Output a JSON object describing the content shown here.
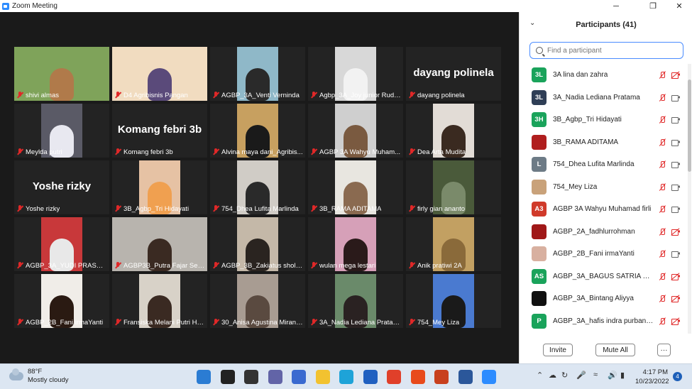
{
  "window": {
    "title": "Zoom Meeting",
    "minimize": "─",
    "maximize": "❐",
    "close": "✕"
  },
  "tiles": [
    {
      "name": "shivi almas",
      "active": true,
      "bg": "#7fa35a",
      "face": "#b07a4a",
      "wide": true
    },
    {
      "name": "D4 Agribisnis Pangan",
      "bg": "#f1dcc0",
      "face": "#5a4a7a",
      "wide": true
    },
    {
      "name": "AGBP_3A_Venti Verninda",
      "bg": "#8fb8c8",
      "face": "#2a2a2a"
    },
    {
      "name": "Agbp_3A_Joy junior Rudd...",
      "bg": "#d8d8d8",
      "face": "#f2f2f2"
    },
    {
      "name": "dayang polinela",
      "text_tile": "dayang polinela"
    },
    {
      "name": "Meylda putri",
      "bg": "#5a5a66",
      "face": "#e8e8f0"
    },
    {
      "name": "Komang febri 3b",
      "text_tile": "Komang febri 3b"
    },
    {
      "name": "Alvina maya dani_Agribis...",
      "bg": "#c7a060",
      "face": "#1a1a1a"
    },
    {
      "name": "AGBP 3A Wahyu Muham...",
      "bg": "#cfcfcf",
      "face": "#7a5a40"
    },
    {
      "name": "Dea Arta Mudita",
      "bg": "#e2dcd6",
      "face": "#3a2a20"
    },
    {
      "name": "Yoshe rizky",
      "text_tile": "Yoshe rizky"
    },
    {
      "name": "3B_Agbp_Tri Hidayati",
      "bg": "#e6c2a4",
      "face": "#f0a050"
    },
    {
      "name": "754_Dhea Lufita Marlinda",
      "bg": "#d0ccc6",
      "face": "#2a2a2a"
    },
    {
      "name": "3B_RAMA ADITAMA",
      "bg": "#e8e6e0",
      "face": "#8a6a50"
    },
    {
      "name": "firly gian ananto",
      "bg": "#4a5a3a",
      "face": "#7a8a6a"
    },
    {
      "name": "AGBP_3A_YUDI PRASETIA",
      "bg": "#c8383a",
      "face": "#e8e8e8"
    },
    {
      "name": "AGBP3B_Putra Fajar Setia...",
      "bg": "#b8b4ae",
      "face": "#3a2a22",
      "wide": true
    },
    {
      "name": "AGBP_3B_Zakiatus sholik...",
      "bg": "#c4b8a8",
      "face": "#2a2420"
    },
    {
      "name": "wulan mega lestari",
      "bg": "#d6a0b8",
      "face": "#2a1a1a"
    },
    {
      "name": "Anik pratiwi 2A",
      "bg": "#c2a062",
      "face": "#8a6a3a"
    },
    {
      "name": "AGBP_2B_Fani irmaYanti",
      "bg": "#f0ede8",
      "face": "#2a1a12"
    },
    {
      "name": "Fransiska Melani Putri Ha...",
      "bg": "#d8d2c8",
      "face": "#3a2a22"
    },
    {
      "name": "30_Anisa Agustina Mirant...",
      "bg": "#a89c92",
      "face": "#5a4a40"
    },
    {
      "name": "3A_Nadia Lediana Pratama",
      "bg": "#6a8a6a",
      "face": "#2a2222"
    },
    {
      "name": "754_Mey Liza",
      "bg": "#4a7ad0",
      "face": "#1a1a1a"
    }
  ],
  "panel": {
    "title": "Participants (41)",
    "search_placeholder": "Find a participant",
    "invite_label": "Invite",
    "mute_all_label": "Mute All",
    "more_label": "···",
    "participants": [
      {
        "initials": "3L",
        "color": "#1aa35b",
        "name": "3A lina dan zahra",
        "cam_off": true
      },
      {
        "initials": "3L",
        "color": "#2f3e56",
        "name": "3A_Nadia Lediana Pratama",
        "cam_off": false
      },
      {
        "initials": "3H",
        "color": "#1aa35b",
        "name": "3B_Agbp_Tri Hidayati",
        "cam_off": false
      },
      {
        "initials": "",
        "color": "#b01e1e",
        "name": "3B_RAMA ADITAMA",
        "cam_off": false
      },
      {
        "initials": "L",
        "color": "#6d7b86",
        "name": "754_Dhea Lufita Marlinda",
        "cam_off": false
      },
      {
        "initials": "",
        "color": "#c9a27a",
        "name": "754_Mey Liza",
        "cam_off": false
      },
      {
        "initials": "A3",
        "color": "#d03a2a",
        "name": "AGBP 3A Wahyu Muhamad firli",
        "cam_off": false
      },
      {
        "initials": "",
        "color": "#a01818",
        "name": "AGBP_2A_fadhlurrohman",
        "cam_off": true
      },
      {
        "initials": "",
        "color": "#d8b0a0",
        "name": "AGBP_2B_Fani irmaYanti",
        "cam_off": false
      },
      {
        "initials": "AS",
        "color": "#1aa35b",
        "name": "AGBP_3A_BAGUS SATRIA PRAT...",
        "cam_off": true
      },
      {
        "initials": "",
        "color": "#101010",
        "name": "AGBP_3A_Bintang Aliyya",
        "cam_off": true
      },
      {
        "initials": "P",
        "color": "#1aa35b",
        "name": "AGBP_3A_hafis indra purbangga",
        "cam_off": true
      }
    ]
  },
  "taskbar": {
    "temp": "88°F",
    "weather": "Mostly cloudy",
    "time": "4:17 PM",
    "date": "10/23/2022",
    "notifications": "4",
    "apps": [
      {
        "icon": "windows-start-icon",
        "color": "#2b7cd3"
      },
      {
        "icon": "search-icon",
        "color": "#222222"
      },
      {
        "icon": "task-view-icon",
        "color": "#333333"
      },
      {
        "icon": "chat-icon",
        "color": "#6264a7"
      },
      {
        "icon": "pen-app-icon",
        "color": "#3a6ad0"
      },
      {
        "icon": "file-explorer-icon",
        "color": "#f2c230"
      },
      {
        "icon": "edge-icon",
        "color": "#1ea3d8"
      },
      {
        "icon": "store-icon",
        "color": "#2060c0"
      },
      {
        "icon": "chrome-icon",
        "color": "#e0402a"
      },
      {
        "icon": "office-icon",
        "color": "#e84a1c"
      },
      {
        "icon": "powerpoint-icon",
        "color": "#c8401e"
      },
      {
        "icon": "word-icon",
        "color": "#2b579a"
      },
      {
        "icon": "zoom-icon",
        "color": "#2d8cff"
      }
    ]
  }
}
